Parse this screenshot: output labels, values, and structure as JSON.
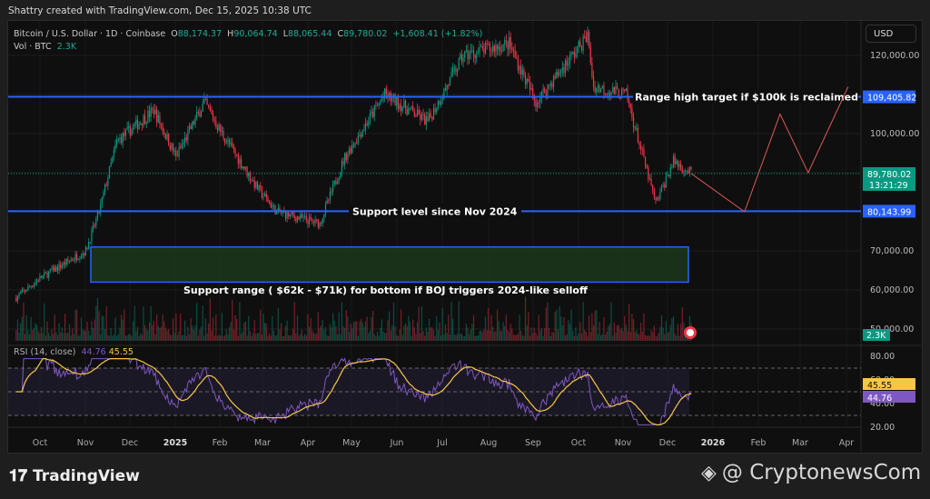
{
  "header": {
    "credit": "Shattry created with TradingView.com, Dec 15, 2025 10:38 UTC",
    "symbol": "Bitcoin / U.S. Dollar · 1D · Coinbase",
    "o_label": "O",
    "o": "88,174.37",
    "h_label": "H",
    "h": "90,064.74",
    "l_label": "L",
    "l": "88,065.44",
    "c_label": "C",
    "c": "89,780.02",
    "change": "+1,608.41 (+1.82%)",
    "vol_label": "Vol · BTC",
    "vol": "2.3K",
    "currency": "USD"
  },
  "rsi": {
    "label": "RSI (14, close)",
    "value": "44.76",
    "ma": "45.55"
  },
  "price_axis": [
    "120,000.00",
    "100,000.00",
    "70,000.00",
    "60,000.00",
    "50,000.00"
  ],
  "rsi_axis": [
    "80.00",
    "60.00",
    "40.00",
    "20.00"
  ],
  "badges": {
    "high": "109,405.82",
    "last": "89,780.02",
    "countdown": "13:21:29",
    "support": "80,143.99",
    "vol": "2.3K",
    "rsi_ma": "45.55",
    "rsi": "44.76"
  },
  "time_axis": [
    "Oct",
    "Nov",
    "Dec",
    "2025",
    "Feb",
    "Mar",
    "Apr",
    "May",
    "Jun",
    "Jul",
    "Aug",
    "Sep",
    "Oct",
    "Nov",
    "Dec",
    "2026",
    "Feb",
    "Mar",
    "Apr"
  ],
  "annotations": {
    "high": "Range high target if $100k is reclaimed",
    "support": "Support level since Nov 2024",
    "range": "Support range ( $62k - $71k) for bottom if BOJ triggers 2024-like selloff"
  },
  "footer": {
    "tv": "TradingView",
    "cn": "@ CryptonewsCom"
  },
  "colors": {
    "up": "#089981",
    "down": "#f23645",
    "line": "#2962ff",
    "rsi": "#7e57c2",
    "rsi_ma": "#f7c548"
  },
  "chart_data": {
    "type": "candlestick",
    "title": "Bitcoin / U.S. Dollar · 1D · Coinbase",
    "x_unit": "days since 2024-09-01",
    "ylim": [
      48000,
      130000
    ],
    "price_path": [
      [
        14,
        58000
      ],
      [
        30,
        63000
      ],
      [
        61,
        70000
      ],
      [
        70,
        80000
      ],
      [
        82,
        98000
      ],
      [
        107,
        106000
      ],
      [
        122,
        94000
      ],
      [
        141,
        108000
      ],
      [
        153,
        100000
      ],
      [
        177,
        86000
      ],
      [
        190,
        80000
      ],
      [
        219,
        77000
      ],
      [
        236,
        94000
      ],
      [
        263,
        110000
      ],
      [
        292,
        103000
      ],
      [
        316,
        120000
      ],
      [
        347,
        123000
      ],
      [
        365,
        108000
      ],
      [
        400,
        125000
      ],
      [
        404,
        112000
      ],
      [
        426,
        110000
      ],
      [
        446,
        82000
      ],
      [
        458,
        93000
      ],
      [
        470,
        89780
      ]
    ],
    "hlines": [
      109405.82,
      80143.99
    ],
    "support_range": [
      62000,
      71000
    ],
    "projection": [
      [
        470,
        89780
      ],
      [
        506,
        80000
      ],
      [
        530,
        105000
      ],
      [
        549,
        90000
      ],
      [
        576,
        112000
      ]
    ],
    "rsi_levels": [
      70,
      50,
      30
    ],
    "rsi_ylim": [
      10,
      90
    ]
  }
}
